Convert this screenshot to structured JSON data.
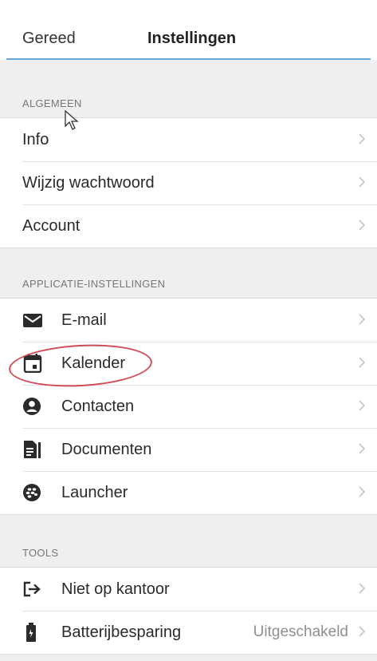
{
  "navbar": {
    "done_label": "Gereed",
    "title": "Instellingen"
  },
  "sections": {
    "general": {
      "header": "ALGEMEEN",
      "items": [
        {
          "label": "Info"
        },
        {
          "label": "Wijzig wachtwoord"
        },
        {
          "label": "Account"
        }
      ]
    },
    "app_settings": {
      "header": "APPLICATIE-INSTELLINGEN",
      "items": [
        {
          "label": "E-mail",
          "icon": "mail-icon"
        },
        {
          "label": "Kalender",
          "icon": "calendar-icon"
        },
        {
          "label": "Contacten",
          "icon": "contact-icon"
        },
        {
          "label": "Documenten",
          "icon": "documents-icon"
        },
        {
          "label": "Launcher",
          "icon": "launcher-icon"
        }
      ]
    },
    "tools": {
      "header": "TOOLS",
      "items": [
        {
          "label": "Niet op kantoor",
          "icon": "out-of-office-icon"
        },
        {
          "label": "Batterijbesparing",
          "icon": "battery-icon",
          "value": "Uitgeschakeld"
        }
      ]
    }
  },
  "colors": {
    "accent_line": "#6aa7d4",
    "highlight": "#d14b55",
    "background": "#efeff2"
  }
}
